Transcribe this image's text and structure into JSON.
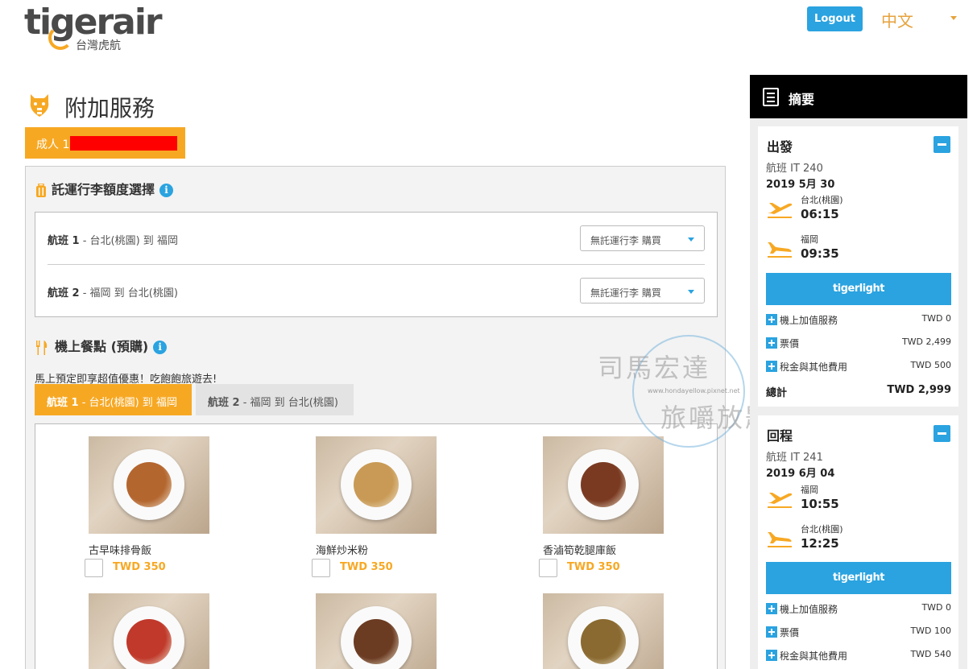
{
  "header": {
    "logo_text": "tigerair",
    "logo_sub": "台灣虎航",
    "logout_label": "Logout",
    "language": "中文"
  },
  "page": {
    "title": "附加服務",
    "passenger_tab": "成人 1"
  },
  "baggage": {
    "heading": "託運行李額度選擇",
    "rows": [
      {
        "flight": "航班 1",
        "route": " - 台北(桃園) 到 福岡",
        "select_value": "無託運行李 購買"
      },
      {
        "flight": "航班 2",
        "route": " - 福岡 到 台北(桃園)",
        "select_value": "無託運行李 購買"
      }
    ]
  },
  "meals": {
    "heading": "機上餐點 (預購)",
    "note": "馬上預定即享超值優惠！吃飽飽旅遊去!",
    "tabs": [
      {
        "flight": "航班 1",
        "route": " - 台北(桃園) 到 福岡"
      },
      {
        "flight": "航班 2",
        "route": " - 福岡 到 台北(桃園)"
      }
    ],
    "items": [
      {
        "name": "古早味排骨飯",
        "price": "TWD 350",
        "color": "#b4662f"
      },
      {
        "name": "海鮮炒米粉",
        "price": "TWD 350",
        "color": "#c99a55"
      },
      {
        "name": "香滷筍乾腿庫飯",
        "price": "TWD 350",
        "color": "#7a3a22"
      },
      {
        "name": "",
        "price": "",
        "color": "#c0392b"
      },
      {
        "name": "",
        "price": "",
        "color": "#6b3b22"
      },
      {
        "name": "",
        "price": "",
        "color": "#8a6a30"
      }
    ]
  },
  "summary": {
    "heading": "摘要",
    "fare_name": "tigerlight",
    "outbound": {
      "title": "出發",
      "flight_no": "航班 IT 240",
      "date": "2019 5月 30",
      "depart_city": "台北(桃園)",
      "depart_time": "06:15",
      "arrive_city": "福岡",
      "arrive_time": "09:35",
      "lines": [
        {
          "label": "機上加值服務",
          "amount": "TWD 0"
        },
        {
          "label": "票價",
          "amount": "TWD 2,499"
        },
        {
          "label": "稅金與其他費用",
          "amount": "TWD 500"
        }
      ],
      "total_label": "總計",
      "total_amount": "TWD 2,999"
    },
    "return": {
      "title": "回程",
      "flight_no": "航班 IT 241",
      "date": "2019 6月 04",
      "depart_city": "福岡",
      "depart_time": "10:55",
      "arrive_city": "台北(桃園)",
      "arrive_time": "12:25",
      "lines": [
        {
          "label": "機上加值服務",
          "amount": "TWD 0"
        },
        {
          "label": "票價",
          "amount": "TWD 100"
        },
        {
          "label": "稅金與其他費用",
          "amount": "TWD 540"
        }
      ]
    }
  },
  "watermark": {
    "line1": "司馬宏達",
    "url": "www.hondayellow.pixnet.net",
    "line2": "旅嚼放題"
  },
  "colors": {
    "brand_orange": "#f7a823",
    "brand_blue": "#2aa3e0"
  }
}
